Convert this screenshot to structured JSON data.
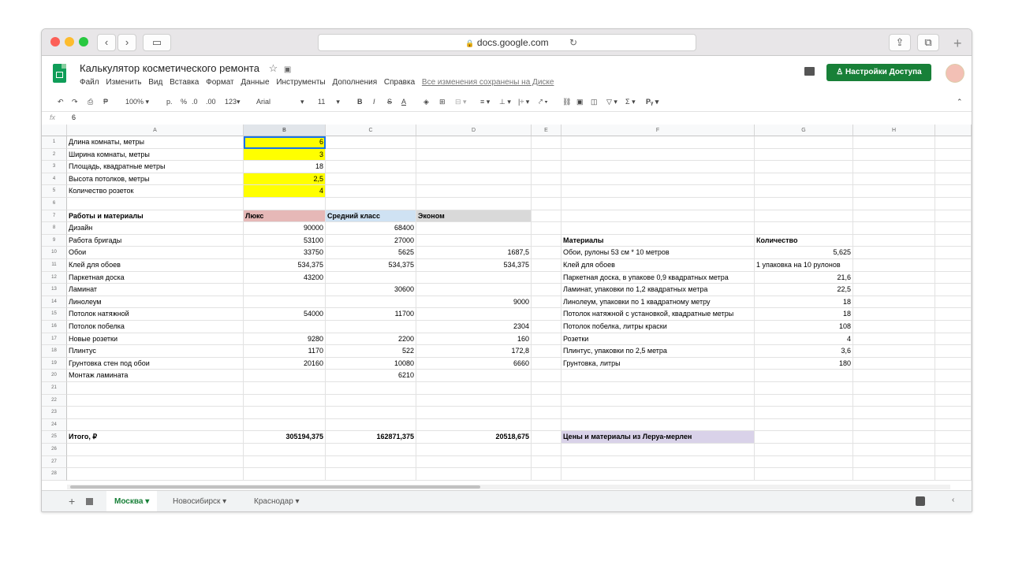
{
  "browser": {
    "url": "docs.google.com",
    "back": "‹",
    "forward": "›"
  },
  "doc": {
    "title": "Калькулятор косметического ремонта",
    "menu": [
      "Файл",
      "Изменить",
      "Вид",
      "Вставка",
      "Формат",
      "Данные",
      "Инструменты",
      "Дополнения",
      "Справка"
    ],
    "saved": "Все изменения сохранены на Диске",
    "share": "Настройки Доступа"
  },
  "toolbar": {
    "zoom": "100%",
    "currency": "р.",
    "percent": "%",
    "dec_less": ".0",
    "dec_more": ".00",
    "format": "123",
    "font": "Arial",
    "size": "11"
  },
  "formula": {
    "fx": "fx",
    "value": "6"
  },
  "columns": [
    "A",
    "B",
    "C",
    "D",
    "E",
    "F",
    "G",
    "H"
  ],
  "rows": [
    {
      "n": "1",
      "A": "Длина комнаты, метры",
      "B": "6"
    },
    {
      "n": "2",
      "A": "Ширина комнаты, метры",
      "B": "3"
    },
    {
      "n": "3",
      "A": "Площадь, квадратные метры",
      "B": "18"
    },
    {
      "n": "4",
      "A": "Высота потолков, метры",
      "B": "2,5"
    },
    {
      "n": "5",
      "A": "Количество розеток",
      "B": "4"
    },
    {
      "n": "6"
    },
    {
      "n": "7",
      "A": "Работы и материалы",
      "B": "Люкс",
      "C": "Средний класс",
      "D": "Эконом"
    },
    {
      "n": "8",
      "A": "Дизайн",
      "B": "90000",
      "C": "68400"
    },
    {
      "n": "9",
      "A": "Работа бригады",
      "B": "53100",
      "C": "27000",
      "F": "Материалы",
      "G": "Количество"
    },
    {
      "n": "10",
      "A": "Обои",
      "B": "33750",
      "C": "5625",
      "D": "1687,5",
      "F": "Обои, рулоны 53 см * 10 метров",
      "G": "5,625"
    },
    {
      "n": "11",
      "A": "Клей для обоев",
      "B": "534,375",
      "C": "534,375",
      "D": "534,375",
      "F": "Клей для обоев",
      "G": "1 упаковка на 10 рулонов"
    },
    {
      "n": "12",
      "A": "Паркетная доска",
      "B": "43200",
      "F": "Паркетная доска, в упакове 0,9 квадратных метра",
      "G": "21,6"
    },
    {
      "n": "13",
      "A": "Ламинат",
      "C": "30600",
      "F": "Ламинат, упаковки по 1,2 квадратных метра",
      "G": "22,5"
    },
    {
      "n": "14",
      "A": "Линолеум",
      "D": "9000",
      "F": "Линолеум, упаковки по 1 квадратному метру",
      "G": "18"
    },
    {
      "n": "15",
      "A": "Потолок натяжной",
      "B": "54000",
      "C": "11700",
      "F": "Потолок натяжной с установкой, квадратные метры",
      "G": "18"
    },
    {
      "n": "16",
      "A": "Потолок побелка",
      "D": "2304",
      "F": "Потолок побелка, литры краски",
      "G": "108"
    },
    {
      "n": "17",
      "A": "Новые розетки",
      "B": "9280",
      "C": "2200",
      "D": "160",
      "F": "Розетки",
      "G": "4"
    },
    {
      "n": "18",
      "A": "Плинтус",
      "B": "1170",
      "C": "522",
      "D": "172,8",
      "F": "Плинтус, упаковки по 2,5 метра",
      "G": "3,6"
    },
    {
      "n": "19",
      "A": "Грунтовка стен под обои",
      "B": "20160",
      "C": "10080",
      "D": "6660",
      "F": "Грунтовка, литры",
      "G": "180"
    },
    {
      "n": "20",
      "A": "Монтаж ламината",
      "C": "6210"
    },
    {
      "n": "21"
    },
    {
      "n": "22"
    },
    {
      "n": "23"
    },
    {
      "n": "24"
    },
    {
      "n": "25",
      "A": "Итого, ₽",
      "B": "305194,375",
      "C": "162871,375",
      "D": "20518,675",
      "F": "Цены и материалы из Леруа-мерлен"
    },
    {
      "n": "26"
    },
    {
      "n": "27"
    },
    {
      "n": "28"
    }
  ],
  "sheets": [
    "Москва",
    "Новосибирск",
    "Краснодар"
  ],
  "colors": {
    "yellow": "#ffff00",
    "pink": "#e6b8b7",
    "blue": "#cfe2f3",
    "gray": "#d9d9d9",
    "lavender": "#d9d2e9",
    "green": "#188038"
  }
}
